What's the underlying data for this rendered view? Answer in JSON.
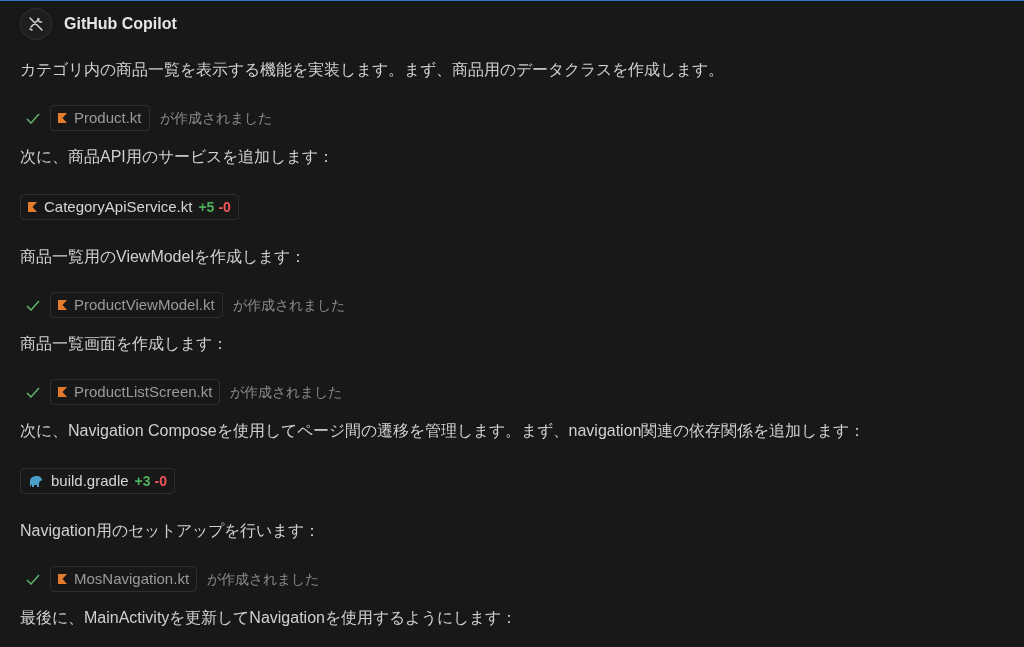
{
  "header": {
    "title": "GitHub Copilot"
  },
  "blocks": [
    {
      "kind": "text",
      "text": "カテゴリ内の商品一覧を表示する機能を実装します。まず、商品用のデータクラスを作成します。"
    },
    {
      "kind": "created",
      "file": "Product.kt",
      "icon": {
        "kind": "kotlin"
      },
      "done": true,
      "status": "が作成されました"
    },
    {
      "kind": "text",
      "text": "次に、商品API用のサービスを追加します："
    },
    {
      "kind": "edit",
      "file": "CategoryApiService.kt",
      "icon": {
        "kind": "kotlin"
      },
      "added": "+5",
      "removed": "-0"
    },
    {
      "kind": "text",
      "text": "商品一覧用のViewModelを作成します："
    },
    {
      "kind": "created",
      "file": "ProductViewModel.kt",
      "icon": {
        "kind": "kotlin"
      },
      "done": true,
      "status": "が作成されました"
    },
    {
      "kind": "text",
      "text": "商品一覧画面を作成します："
    },
    {
      "kind": "created",
      "file": "ProductListScreen.kt",
      "icon": {
        "kind": "kotlin"
      },
      "done": true,
      "status": "が作成されました"
    },
    {
      "kind": "text",
      "text": "次に、Navigation Composeを使用してページ間の遷移を管理します。まず、navigation関連の依存関係を追加します："
    },
    {
      "kind": "edit",
      "file": "build.gradle",
      "icon": {
        "kind": "gradle"
      },
      "added": "+3",
      "removed": "-0"
    },
    {
      "kind": "text",
      "text": "Navigation用のセットアップを行います："
    },
    {
      "kind": "created",
      "file": "MosNavigation.kt",
      "icon": {
        "kind": "kotlin"
      },
      "done": true,
      "status": "が作成されました"
    },
    {
      "kind": "text",
      "text": "最後に、MainActivityを更新してNavigationを使用するようにします："
    }
  ]
}
